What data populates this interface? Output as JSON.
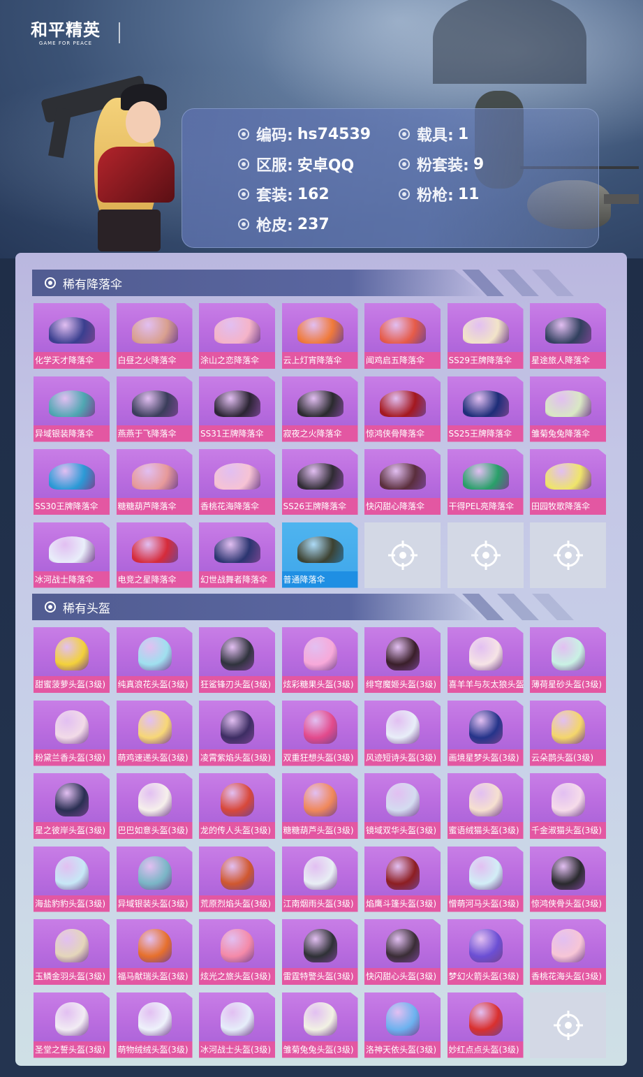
{
  "brand": {
    "logo_main": "和平精英",
    "logo_sub": "GAME FOR PEACE"
  },
  "account": {
    "left": [
      {
        "key": "编码:",
        "value": "hs74539"
      },
      {
        "key": "区服:",
        "value": "安卓QQ"
      },
      {
        "key": "套装:",
        "value": "162"
      },
      {
        "key": "枪皮:",
        "value": "237"
      }
    ],
    "right": [
      {
        "key": "载具:",
        "value": "1"
      },
      {
        "key": "粉套装:",
        "value": "9"
      },
      {
        "key": "粉枪:",
        "value": "11"
      }
    ]
  },
  "sections": {
    "parachutes": {
      "title": "稀有降落伞",
      "items": [
        {
          "name": "化学天才降落伞",
          "color": "#3a3f8f"
        },
        {
          "name": "白昼之火降落伞",
          "color": "#d9a08f"
        },
        {
          "name": "涂山之恋降落伞",
          "color": "#f5b4c8"
        },
        {
          "name": "云上灯宵降落伞",
          "color": "#f07a3a"
        },
        {
          "name": "闻鸡启五降落伞",
          "color": "#e65b48"
        },
        {
          "name": "SS29王牌降落伞",
          "color": "#f2e4c8"
        },
        {
          "name": "星途旅人降落伞",
          "color": "#31405e"
        },
        {
          "name": "异域银装降落伞",
          "color": "#4fa7b2"
        },
        {
          "name": "燕燕于飞降落伞",
          "color": "#3a3d5a"
        },
        {
          "name": "SS31王牌降落伞",
          "color": "#2b2433"
        },
        {
          "name": "寂夜之火降落伞",
          "color": "#2a2a2e"
        },
        {
          "name": "惊鸿侠骨降落伞",
          "color": "#a4181f"
        },
        {
          "name": "SS25王牌降落伞",
          "color": "#1d2d78"
        },
        {
          "name": "雏菊兔兔降落伞",
          "color": "#d9e8c4"
        },
        {
          "name": "SS30王牌降落伞",
          "color": "#2b9ad6"
        },
        {
          "name": "糖糖葫芦降落伞",
          "color": "#e79a9a"
        },
        {
          "name": "香桃花海降落伞",
          "color": "#f6c3d4"
        },
        {
          "name": "SS26王牌降落伞",
          "color": "#2f2b33"
        },
        {
          "name": "快闪甜心降落伞",
          "color": "#5a2e3c"
        },
        {
          "name": "干得PEL亮降落伞",
          "color": "#29a069"
        },
        {
          "name": "田园牧歌降落伞",
          "color": "#efe56a"
        },
        {
          "name": "冰河战士降落伞",
          "color": "#e9eefa"
        },
        {
          "name": "电竞之星降落伞",
          "color": "#d62b3a"
        },
        {
          "name": "幻世战舞者降落伞",
          "color": "#2b3570"
        },
        {
          "name": "普通降落伞",
          "color": "#3d4231",
          "highlight": true
        }
      ],
      "empty_slots": 3
    },
    "helmets": {
      "title": "稀有头盔",
      "items": [
        {
          "name": "甜蜜菠萝头盔(3级)",
          "color": "#f3d13a"
        },
        {
          "name": "纯真浪花头盔(3级)",
          "color": "#9fe0ef"
        },
        {
          "name": "狂鲨锋刃头盔(3级)",
          "color": "#30333d"
        },
        {
          "name": "炫彩糖果头盔(3级)",
          "color": "#f7a9d9"
        },
        {
          "name": "绯穹魔姬头盔(3级)",
          "color": "#3a1f2a"
        },
        {
          "name": "喜羊羊与灰太狼头盔(3级)",
          "color": "#f6e4e6"
        },
        {
          "name": "薄荷星砂头盔(3级)",
          "color": "#c9f2e4"
        },
        {
          "name": "粉黛兰香头盔(3级)",
          "color": "#f2dbe8"
        },
        {
          "name": "萌鸡速递头盔(3级)",
          "color": "#f7d776"
        },
        {
          "name": "凌霄紫焰头盔(3级)",
          "color": "#3d2d63"
        },
        {
          "name": "双重狂想头盔(3级)",
          "color": "#e24a8c"
        },
        {
          "name": "风迹短诗头盔(3级)",
          "color": "#e8eef8"
        },
        {
          "name": "画境星梦头盔(3级)",
          "color": "#25348a"
        },
        {
          "name": "云朵鹊头盔(3级)",
          "color": "#f4d66a"
        },
        {
          "name": "星之彼岸头盔(3级)",
          "color": "#2a2f52"
        },
        {
          "name": "巴巴如意头盔(3级)",
          "color": "#f6f0ec"
        },
        {
          "name": "龙的传人头盔(3级)",
          "color": "#d8483a"
        },
        {
          "name": "糖糖葫芦头盔(3级)",
          "color": "#f0885a"
        },
        {
          "name": "镜域双华头盔(3级)",
          "color": "#d4dcf0"
        },
        {
          "name": "蜜语绒猫头盔(3级)",
          "color": "#f6e0d0"
        },
        {
          "name": "千金淑猫头盔(3级)",
          "color": "#f6dcea"
        },
        {
          "name": "海盐豹豹头盔(3级)",
          "color": "#c7e8f6"
        },
        {
          "name": "异域银装头盔(3级)",
          "color": "#7ab6c6"
        },
        {
          "name": "荒原烈焰头盔(3级)",
          "color": "#d0582f"
        },
        {
          "name": "江南烟雨头盔(3级)",
          "color": "#e8eef4"
        },
        {
          "name": "焰鹰斗篷头盔(3级)",
          "color": "#8d1e22"
        },
        {
          "name": "憎萌河马头盔(3级)",
          "color": "#d2eef6"
        },
        {
          "name": "惊鸿侠骨头盔(3级)",
          "color": "#2a2a2e"
        },
        {
          "name": "玉鳞金羽头盔(3级)",
          "color": "#e4d6ba"
        },
        {
          "name": "福马献瑞头盔(3级)",
          "color": "#e6702c"
        },
        {
          "name": "炫光之旅头盔(3级)",
          "color": "#f48aa8"
        },
        {
          "name": "雷霆特警头盔(3级)",
          "color": "#2f3136"
        },
        {
          "name": "快闪甜心头盔(3级)",
          "color": "#3a2d36"
        },
        {
          "name": "梦幻火箭头盔(3级)",
          "color": "#6b4fd4"
        },
        {
          "name": "香桃花海头盔(3级)",
          "color": "#f7c6d6"
        },
        {
          "name": "圣堂之誓头盔(3级)",
          "color": "#f2ecf4"
        },
        {
          "name": "萌物绒绒头盔(3级)",
          "color": "#eef2fb"
        },
        {
          "name": "冰河战士头盔(3级)",
          "color": "#e6eefa"
        },
        {
          "name": "雏菊兔兔头盔(3级)",
          "color": "#f2f2e4"
        },
        {
          "name": "洛神天依头盔(3级)",
          "color": "#6cb2ef"
        },
        {
          "name": "妙红点点头盔(3级)",
          "color": "#d9302e"
        }
      ],
      "empty_slots": 1
    }
  }
}
